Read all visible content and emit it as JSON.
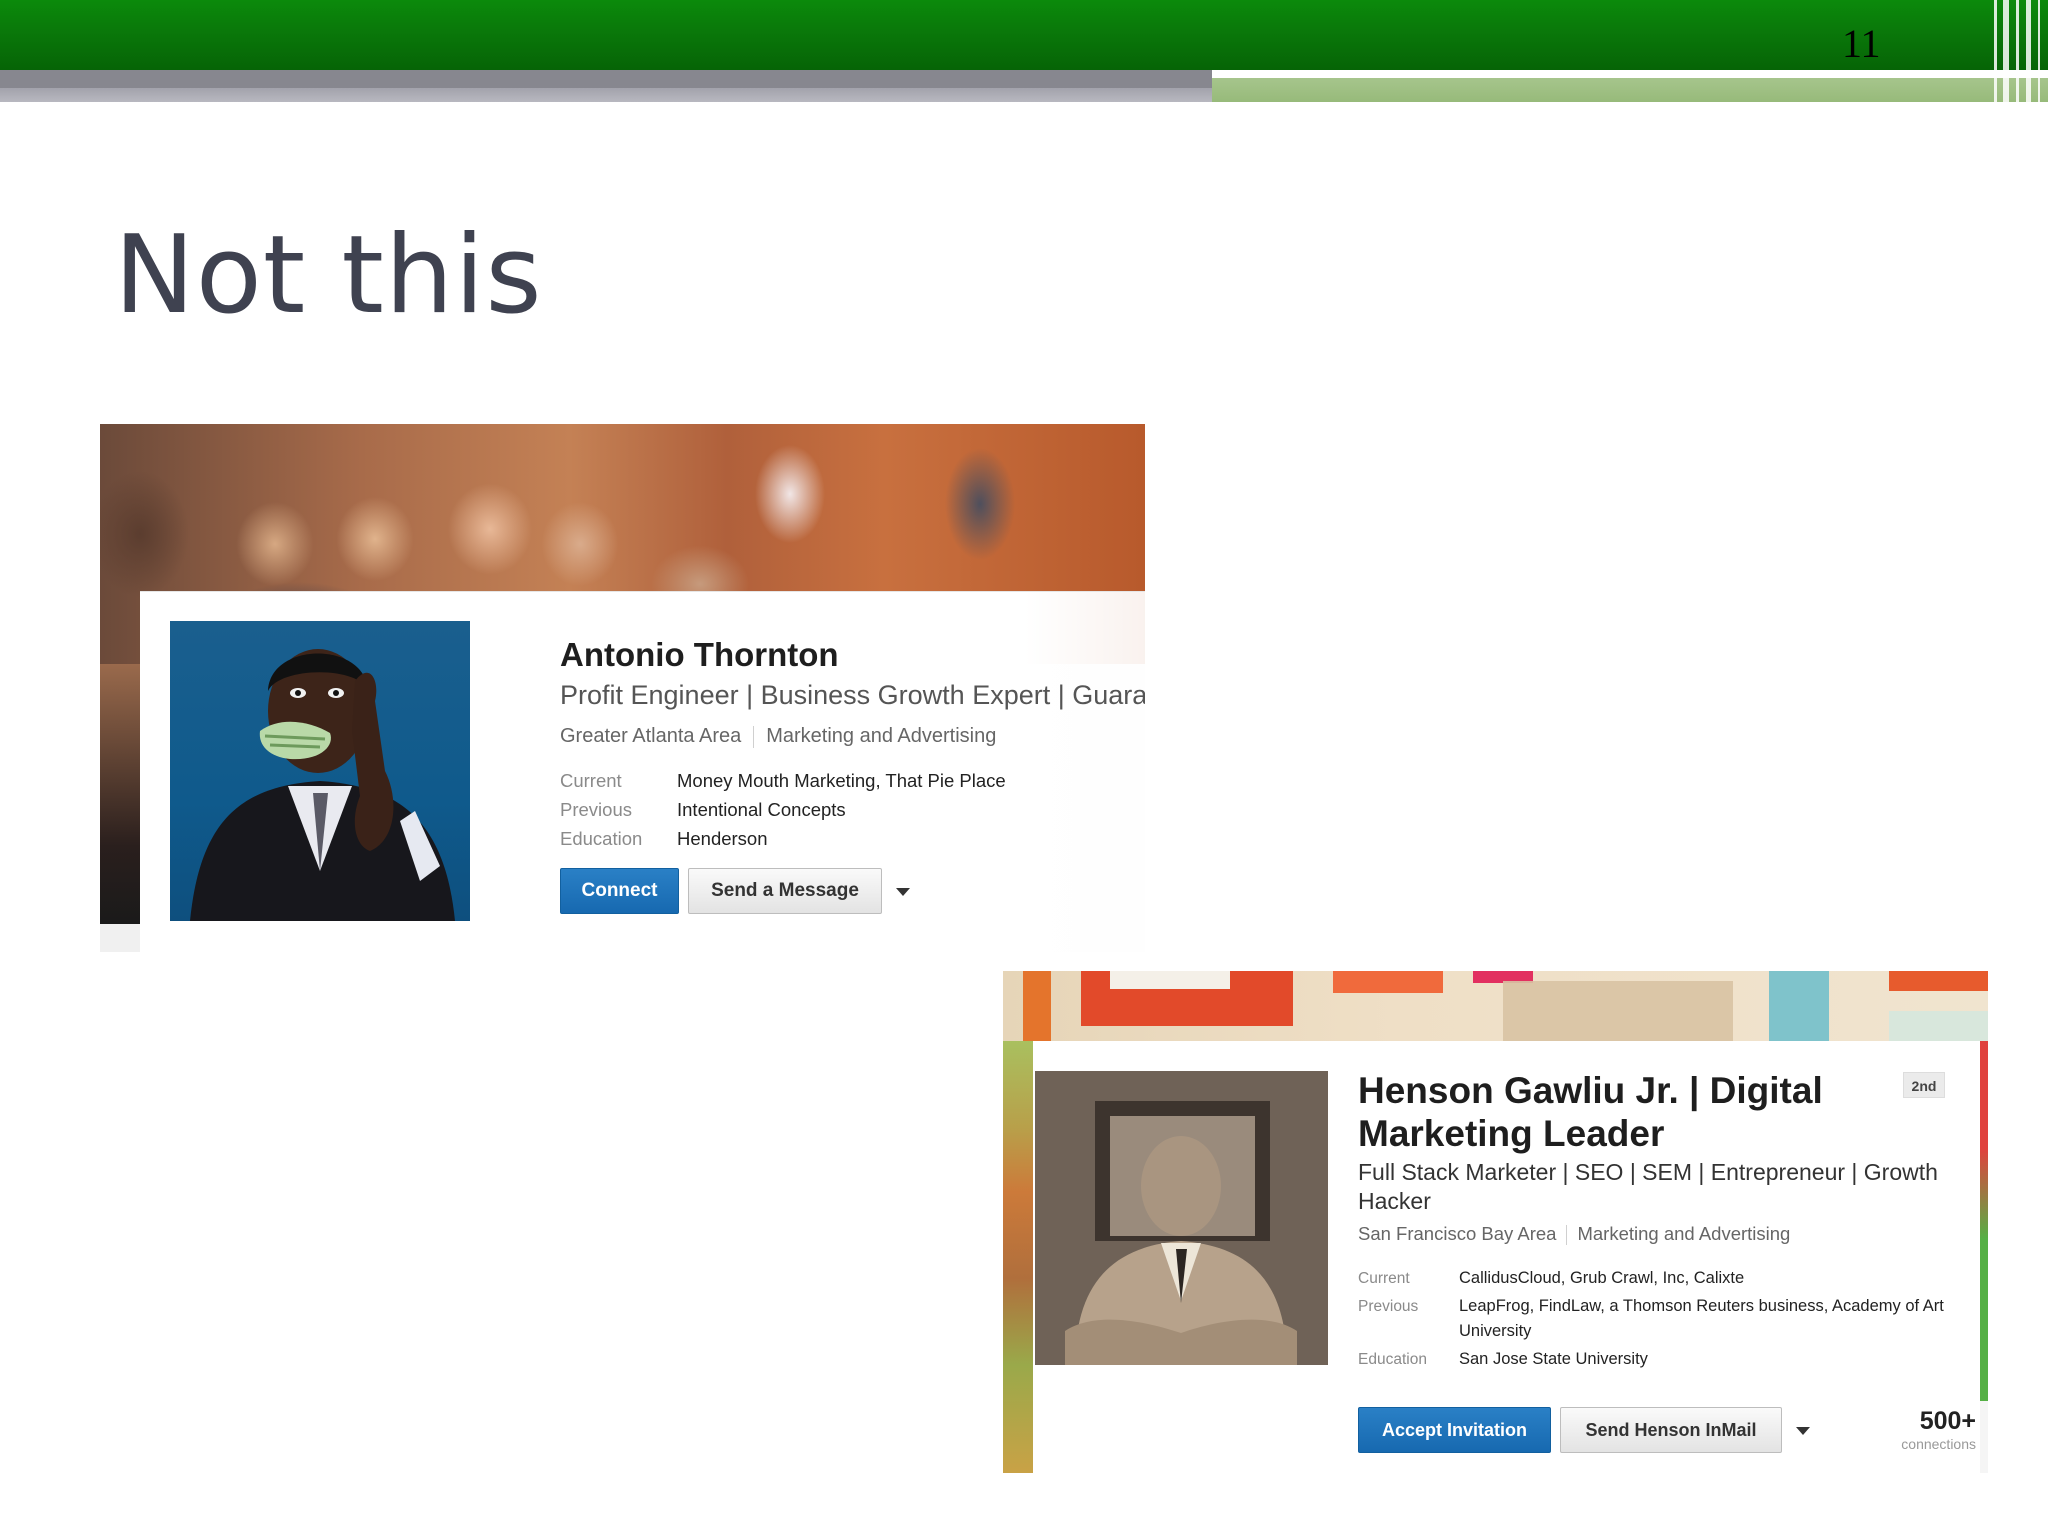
{
  "slide": {
    "number": "11",
    "title": "Not this"
  },
  "colors": {
    "header_green": "#0a7a0a",
    "title_text": "#3f4250",
    "linkedin_blue": "#1f75ba"
  },
  "profile1": {
    "name": "Antonio Thornton",
    "headline": "Profit Engineer | Business Growth Expert | Guara",
    "location": "Greater Atlanta Area",
    "industry": "Marketing and Advertising",
    "rows": [
      {
        "label": "Current",
        "value": "Money Mouth Marketing, That Pie Place"
      },
      {
        "label": "Previous",
        "value": "Intentional Concepts"
      },
      {
        "label": "Education",
        "value": "Henderson"
      }
    ],
    "connect_label": "Connect",
    "message_label": "Send a Message",
    "more_icon": "caret-down-icon"
  },
  "profile2": {
    "name": "Henson Gawliu Jr. | Digital Marketing Leader",
    "degree_badge": "2nd",
    "headline": "Full Stack Marketer | SEO | SEM | Entrepreneur | Growth Hacker",
    "location": "San Francisco Bay Area",
    "industry": "Marketing and Advertising",
    "rows": [
      {
        "label": "Current",
        "value": "CallidusCloud, Grub Crawl, Inc, Calixte"
      },
      {
        "label": "Previous",
        "value": "LeapFrog, FindLaw, a Thomson Reuters business, Academy of Art University"
      },
      {
        "label": "Education",
        "value": "San Jose State University"
      }
    ],
    "accept_label": "Accept Invitation",
    "inmail_label": "Send Henson InMail",
    "connections_count": "500+",
    "connections_label": "connections",
    "more_icon": "caret-down-icon"
  }
}
